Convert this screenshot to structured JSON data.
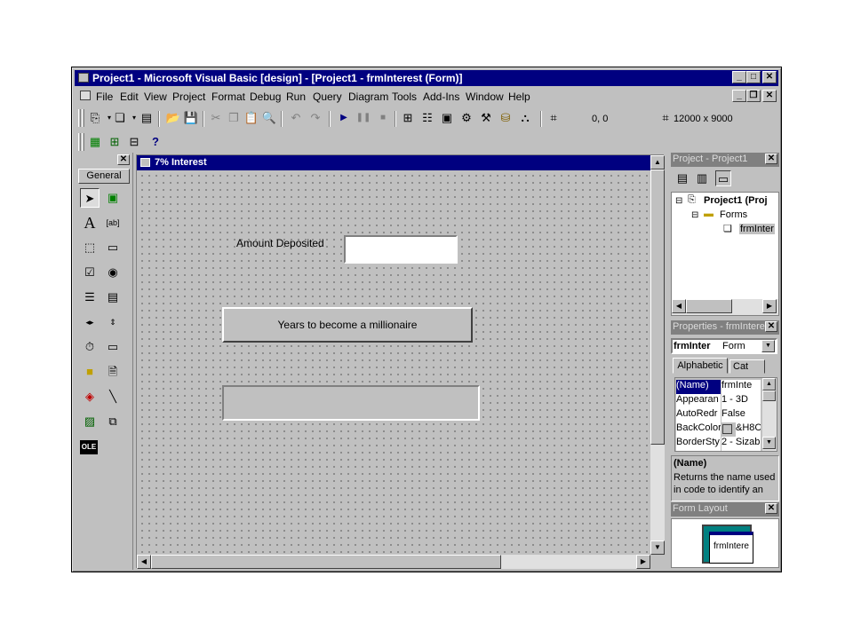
{
  "window": {
    "title": "Project1 - Microsoft Visual Basic [design] - [Project1 - frmInterest (Form)]",
    "minimize": "_",
    "maximize": "□",
    "close": "✕",
    "restore": "❐"
  },
  "menu": {
    "items": [
      "File",
      "Edit",
      "View",
      "Project",
      "Format",
      "Debug",
      "Run",
      "Query",
      "Diagram",
      "Tools",
      "Add-Ins",
      "Window",
      "Help"
    ]
  },
  "toolbar": {
    "position_readout": "0, 0",
    "size_readout": "12000 x 9000"
  },
  "toolbox": {
    "close": "✕",
    "tab": "General",
    "icons": [
      "pointer-icon",
      "picturebox-icon",
      "label-icon",
      "textbox-icon",
      "frame-icon",
      "commandbutton-icon",
      "checkbox-icon",
      "optionbutton-icon",
      "combobox-icon",
      "listbox-icon",
      "hscrollbar-icon",
      "vscrollbar-icon",
      "timer-icon",
      "drivelistbox-icon",
      "dirlistbox-icon",
      "filelistbox-icon",
      "shape-icon",
      "line-icon",
      "image-icon",
      "data-icon",
      "ole-icon"
    ]
  },
  "form": {
    "title": "7% Interest",
    "label_amount": "Amount Deposited",
    "amount_value": "",
    "button_years": "Years to become a millionaire",
    "result_value": ""
  },
  "project_panel": {
    "title": "Project - Project1",
    "close": "✕",
    "root": "Project1 (Proj",
    "folder": "Forms",
    "form_item": "frmInter",
    "expand_minus": "⊟"
  },
  "properties_panel": {
    "title": "Properties - frmInterest",
    "close": "✕",
    "object_name": "frmInter",
    "object_type": "Form",
    "tab_alphabetic": "Alphabetic",
    "tab_categorized": "Cat",
    "rows": [
      {
        "name": "(Name)",
        "value": "frmInte"
      },
      {
        "name": "Appearan",
        "value": "1 - 3D"
      },
      {
        "name": "AutoRedr",
        "value": "False"
      },
      {
        "name": "BackColor",
        "value": "&H8C"
      },
      {
        "name": "BorderSty",
        "value": "2 - Sizab"
      }
    ],
    "desc_title": "(Name)",
    "desc_text": "Returns the name used in code to identify an"
  },
  "layout_panel": {
    "title": "Form Layout",
    "close": "✕",
    "form_label": "frmIntere"
  },
  "colors": {
    "title_active": "#000080",
    "title_inactive": "#808080",
    "face": "#c0c0c0"
  }
}
